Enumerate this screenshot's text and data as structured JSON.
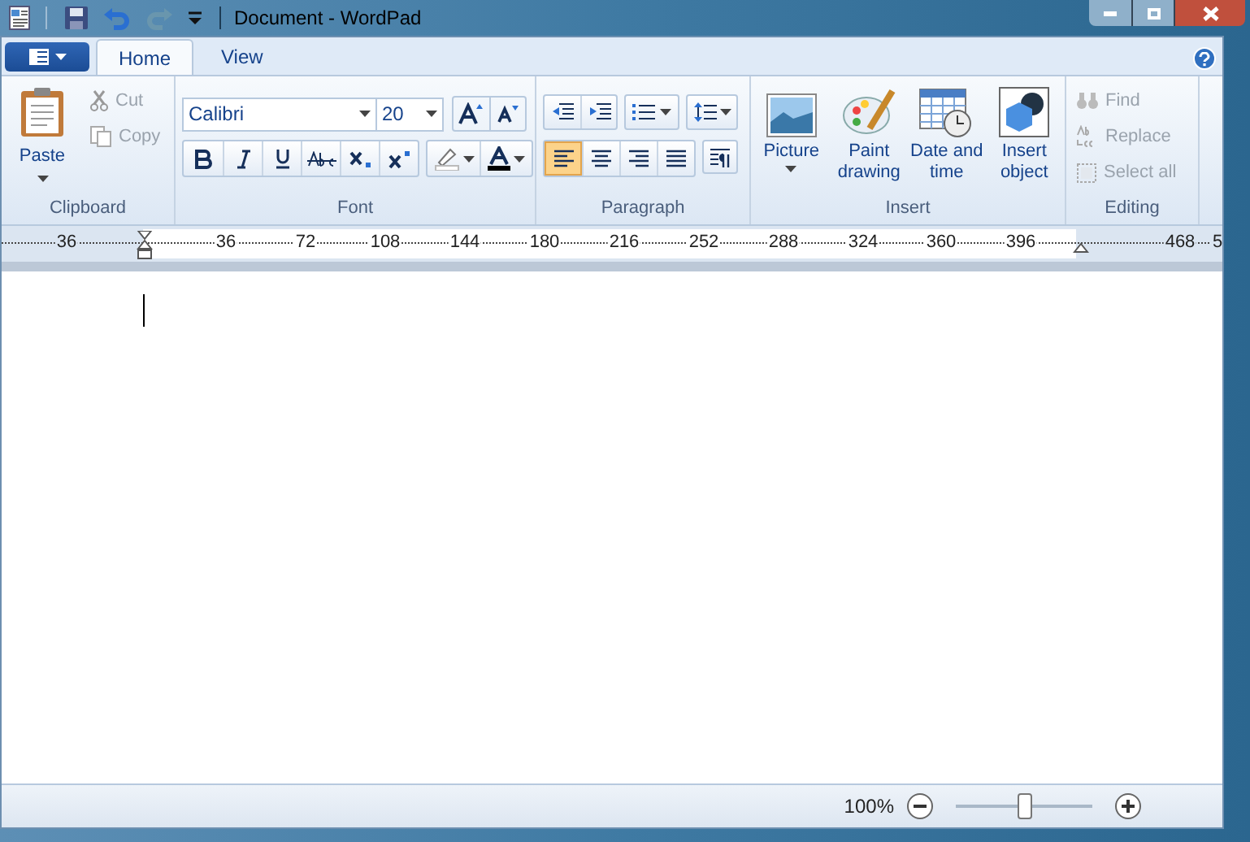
{
  "title_bar": {
    "title": "Document - WordPad",
    "quick_access": [
      {
        "kind": "save",
        "disabled": false
      },
      {
        "kind": "undo",
        "disabled": false
      },
      {
        "kind": "redo",
        "disabled": true
      },
      {
        "kind": "customize",
        "disabled": false
      }
    ]
  },
  "tabs": [
    {
      "label": "Home",
      "selected": true
    },
    {
      "label": "View",
      "selected": false
    }
  ],
  "clipboard": {
    "label": "Clipboard",
    "paste": "Paste",
    "items": [
      {
        "kind": "cut",
        "label": "Cut",
        "disabled": true
      },
      {
        "kind": "copy",
        "label": "Copy",
        "disabled": true
      }
    ]
  },
  "font": {
    "label": "Font",
    "font_name": "Calibri",
    "font_size": "20",
    "buttons": [
      {
        "kind": "bold",
        "selected": false
      },
      {
        "kind": "italic",
        "selected": false
      },
      {
        "kind": "underline",
        "selected": false
      },
      {
        "kind": "strike",
        "selected": false
      },
      {
        "kind": "sub",
        "selected": false
      },
      {
        "kind": "sup",
        "selected": false
      }
    ]
  },
  "paragraph": {
    "label": "Paragraph",
    "alignment": [
      {
        "kind": "left",
        "selected": true
      },
      {
        "kind": "center",
        "selected": false
      },
      {
        "kind": "right",
        "selected": false
      },
      {
        "kind": "justify",
        "selected": false
      }
    ]
  },
  "insert": {
    "label": "Insert",
    "items": [
      {
        "kind": "picture",
        "label": "Picture",
        "dropdown": true
      },
      {
        "kind": "paint",
        "label": "Paint drawing",
        "dropdown": false
      },
      {
        "kind": "date",
        "label": "Date and time",
        "dropdown": false
      },
      {
        "kind": "object",
        "label": "Insert object",
        "dropdown": false
      }
    ]
  },
  "editing": {
    "label": "Editing",
    "items": [
      {
        "kind": "find",
        "label": "Find",
        "disabled": true
      },
      {
        "kind": "replace",
        "label": "Replace",
        "disabled": true
      },
      {
        "kind": "selectall",
        "label": "Select all",
        "disabled": true
      }
    ]
  },
  "ruler": {
    "labels": [
      "36",
      "36",
      "72",
      "108",
      "144",
      "180",
      "216",
      "252",
      "288",
      "324",
      "360",
      "396",
      "468",
      "5"
    ]
  },
  "status_bar": {
    "zoom": "100%",
    "zoom_slider": {
      "level": 0.5
    }
  }
}
